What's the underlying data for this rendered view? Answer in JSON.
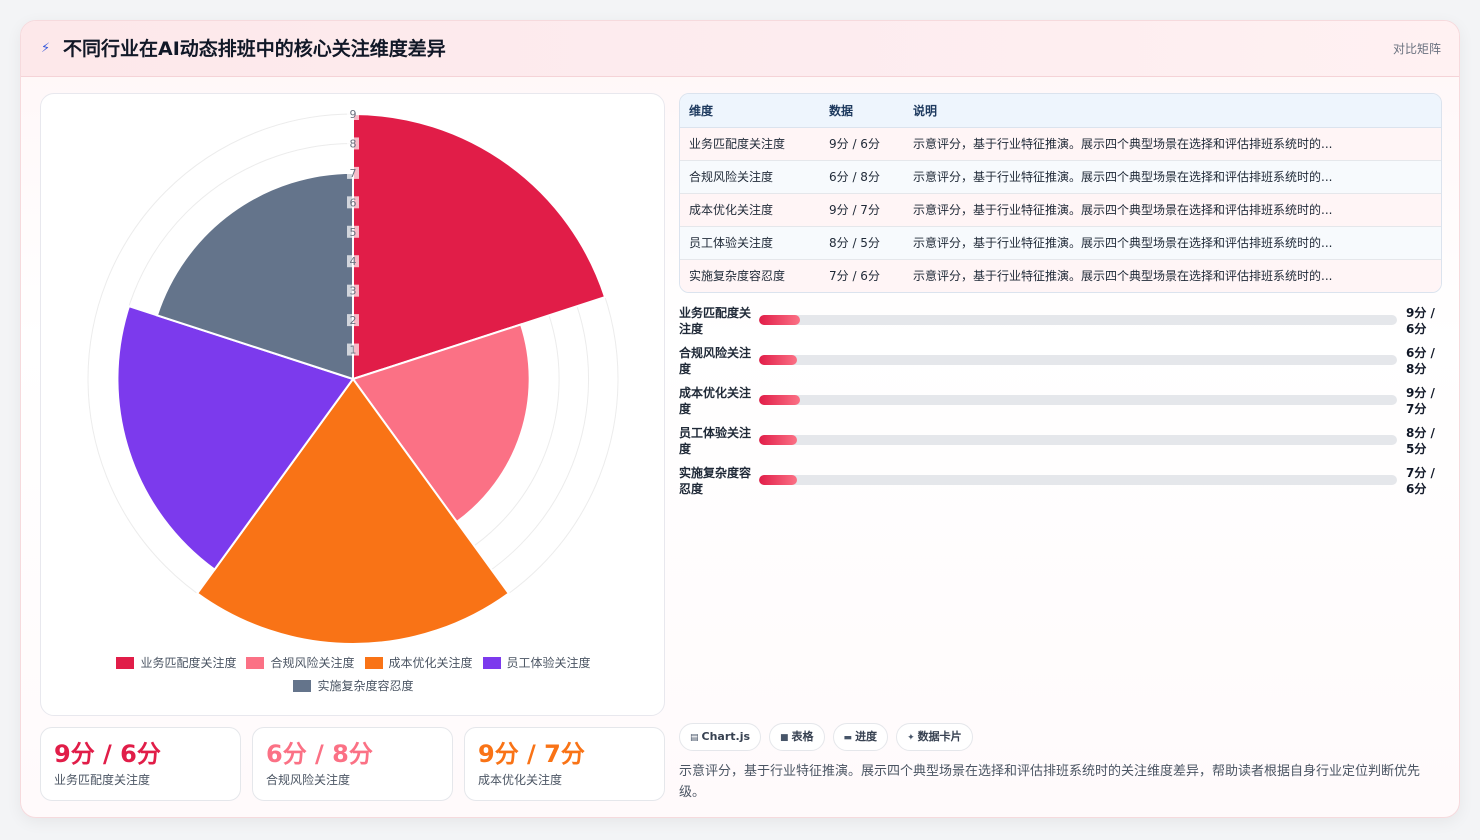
{
  "header": {
    "title": "不同行业在AI动态排班中的核心关注维度差异",
    "tag": "对比矩阵"
  },
  "colors": {
    "accent": "#e11d48",
    "series": [
      "#e11d48",
      "#fb7185",
      "#f97316",
      "#7c3aed",
      "#64748b"
    ]
  },
  "chart_data": {
    "type": "polarArea",
    "categories": [
      "业务匹配度关注度",
      "合规风险关注度",
      "成本优化关注度",
      "员工体验关注度",
      "实施复杂度容忍度"
    ],
    "values": [
      9,
      6,
      9,
      8,
      7
    ],
    "colors": [
      "#e11d48",
      "#fb7185",
      "#f97316",
      "#7c3aed",
      "#64748b"
    ],
    "r_range": [
      0,
      9
    ],
    "r_ticks": [
      1,
      2,
      3,
      4,
      5,
      6,
      7,
      8,
      9
    ],
    "legend_position": "bottom",
    "grid": true
  },
  "legend": {
    "items": [
      {
        "label": "业务匹配度关注度",
        "color": "#e11d48"
      },
      {
        "label": "合规风险关注度",
        "color": "#fb7185"
      },
      {
        "label": "成本优化关注度",
        "color": "#f97316"
      },
      {
        "label": "员工体验关注度",
        "color": "#7c3aed"
      },
      {
        "label": "实施复杂度容忍度",
        "color": "#64748b"
      }
    ]
  },
  "stats": [
    {
      "value": "9分 / 6分",
      "label": "业务匹配度关注度",
      "color": "#e11d48"
    },
    {
      "value": "6分 / 8分",
      "label": "合规风险关注度",
      "color": "#fb7185"
    },
    {
      "value": "9分 / 7分",
      "label": "成本优化关注度",
      "color": "#f97316"
    }
  ],
  "table": {
    "headers": [
      "维度",
      "数据",
      "说明"
    ],
    "rows": [
      [
        "业务匹配度关注度",
        "9分 / 6分",
        "示意评分，基于行业特征推演。展示四个典型场景在选择和评估排班系统时的..."
      ],
      [
        "合规风险关注度",
        "6分 / 8分",
        "示意评分，基于行业特征推演。展示四个典型场景在选择和评估排班系统时的..."
      ],
      [
        "成本优化关注度",
        "9分 / 7分",
        "示意评分，基于行业特征推演。展示四个典型场景在选择和评估排班系统时的..."
      ],
      [
        "员工体验关注度",
        "8分 / 5分",
        "示意评分，基于行业特征推演。展示四个典型场景在选择和评估排班系统时的..."
      ],
      [
        "实施复杂度容忍度",
        "7分 / 6分",
        "示意评分，基于行业特征推演。展示四个典型场景在选择和评估排班系统时的..."
      ]
    ]
  },
  "bars": [
    {
      "label": "业务匹配度关注度",
      "value": "9分 / 6分",
      "fill_percent": 6.5
    },
    {
      "label": "合规风险关注度",
      "value": "6分 / 8分",
      "fill_percent": 6
    },
    {
      "label": "成本优化关注度",
      "value": "9分 / 7分",
      "fill_percent": 6.5
    },
    {
      "label": "员工体验关注度",
      "value": "8分 / 5分",
      "fill_percent": 6
    },
    {
      "label": "实施复杂度容忍度",
      "value": "7分 / 6分",
      "fill_percent": 6
    }
  ],
  "chips": [
    {
      "icon": "▤",
      "label": "Chart.js"
    },
    {
      "icon": "■",
      "label": "表格"
    },
    {
      "icon": "▬",
      "label": "进度"
    },
    {
      "icon": "✦",
      "label": "数据卡片"
    }
  ],
  "note": "示意评分，基于行业特征推演。展示四个典型场景在选择和评估排班系统时的关注维度差异，帮助读者根据自身行业定位判断优先级。"
}
